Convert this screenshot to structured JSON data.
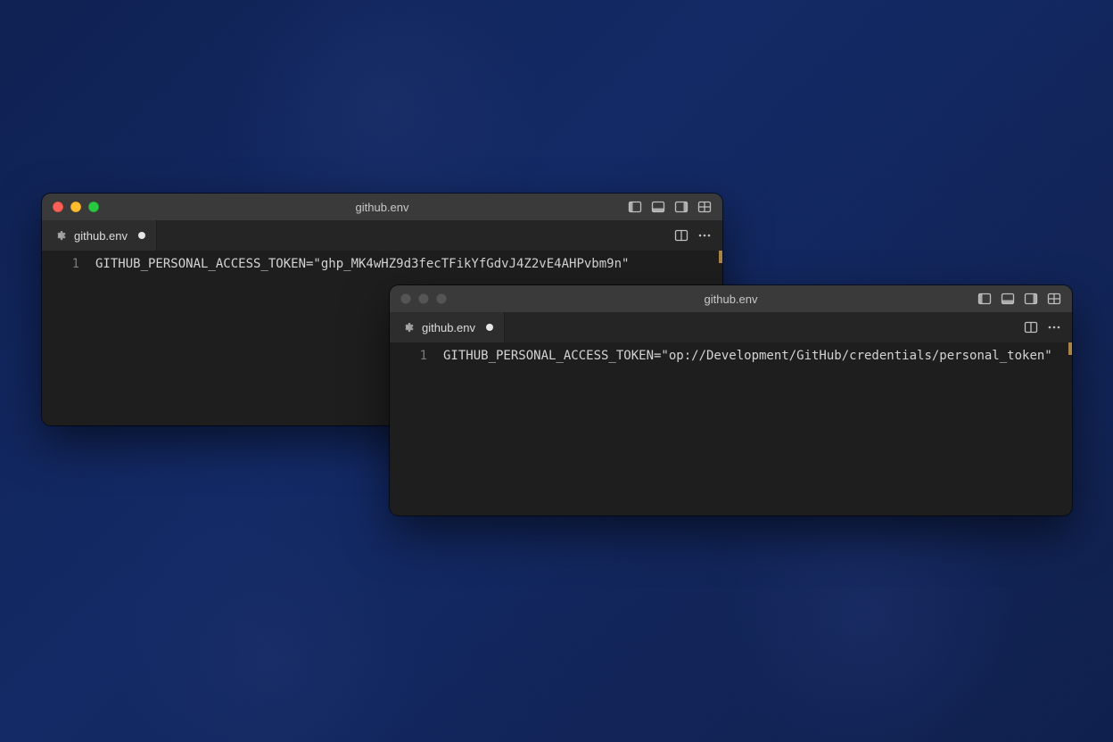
{
  "windows": {
    "win1": {
      "title": "github.env",
      "active": true,
      "tab": {
        "icon": "gear-icon",
        "label": "github.env",
        "dirty": true
      },
      "editor": {
        "line_number": "1",
        "content": "GITHUB_PERSONAL_ACCESS_TOKEN=\"ghp_MK4wHZ9d3fecTFikYfGdvJ4Z2vE4AHPvbm9n\""
      }
    },
    "win2": {
      "title": "github.env",
      "active": false,
      "tab": {
        "icon": "gear-icon",
        "label": "github.env",
        "dirty": true
      },
      "editor": {
        "line_number": "1",
        "content": "GITHUB_PERSONAL_ACCESS_TOKEN=\"op://Development/GitHub/credentials/personal_token\""
      }
    }
  },
  "icons": {
    "gear": "gear-icon",
    "split": "split-editor-icon",
    "more": "more-icon",
    "layout_side": "toggle-sidebar-icon",
    "layout_bottom": "toggle-panel-icon",
    "layout_right": "toggle-secondary-sidebar-icon",
    "layout_custom": "customize-layout-icon"
  }
}
